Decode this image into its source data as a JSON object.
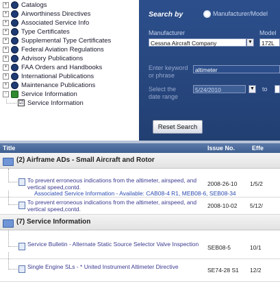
{
  "tree": {
    "items": [
      {
        "label": "Catalogs",
        "expander": "+",
        "icon": "catalog-icon"
      },
      {
        "label": "Airworthiness Directives",
        "expander": "+",
        "icon": "catalog-icon"
      },
      {
        "label": "Associated Service Info",
        "expander": "+",
        "icon": "catalog-icon"
      },
      {
        "label": "Type Certificates",
        "expander": "+",
        "icon": "catalog-icon"
      },
      {
        "label": "Supplemental Type Certificates",
        "expander": "+",
        "icon": "catalog-icon"
      },
      {
        "label": "Federal Aviation Regulations",
        "expander": "+",
        "icon": "catalog-icon"
      },
      {
        "label": "Advisory Publications",
        "expander": "+",
        "icon": "catalog-icon"
      },
      {
        "label": "FAA Orders and Handbooks",
        "expander": "+",
        "icon": "catalog-icon"
      },
      {
        "label": "International Publications",
        "expander": "+",
        "icon": "catalog-icon"
      },
      {
        "label": "Maintenance Publications",
        "expander": "+",
        "icon": "catalog-icon"
      },
      {
        "label": "Service Information",
        "expander": "-",
        "icon": "checked-folder-icon"
      }
    ],
    "child": {
      "label": "Service Information",
      "checked": "☑"
    }
  },
  "search": {
    "search_by_label": "Search by",
    "radio_label": "Manufacturer/Model",
    "manufacturer_label": "Manufacturer",
    "manufacturer_value": "Cessna Aircraft Company",
    "model_label": "Model",
    "model_value": "172L",
    "keyword_label_1": "Enter keyword",
    "keyword_label_2": "or phrase",
    "keyword_value": "altimeter",
    "date_label_1": "Select the",
    "date_label_2": "date range",
    "date_from": "5/24/2010",
    "date_to_label": "to",
    "reset_label": "Reset Search"
  },
  "table": {
    "columns": [
      "Title",
      "Issue No.",
      "Effe"
    ],
    "groups": [
      {
        "title": "(2) Airframe ADs - Small Aircraft and Rotor",
        "rows": [
          {
            "desc": "To prevent erroneous indications from the altimeter, airspeed, and vertical speed,contd.",
            "issue": "2008-26-10",
            "eff": "1/5/2",
            "assoc": "Associated Service Information - Available: CAB08-4 R1, MEB08-6, SEB08-34"
          },
          {
            "desc": "To prevent erroneous indications from the altimeter, airspeed, and vertical speed,contd.",
            "issue": "2008-10-02",
            "eff": "5/12/"
          }
        ]
      },
      {
        "title": "(7) Service Information",
        "rows": [
          {
            "desc": "Service Bulletin - Alternate Static Source Selector Valve Inspection",
            "issue": "SEB08-5",
            "eff": "10/1"
          },
          {
            "desc": "Single Engine SLs - * United Instrument Altimeter Directive",
            "issue": "SE74-28 S1",
            "eff": "12/2"
          }
        ]
      }
    ]
  },
  "colors": {
    "panel": "#2c4f8c",
    "header": "#3e5f91",
    "link": "#3a3a90"
  }
}
